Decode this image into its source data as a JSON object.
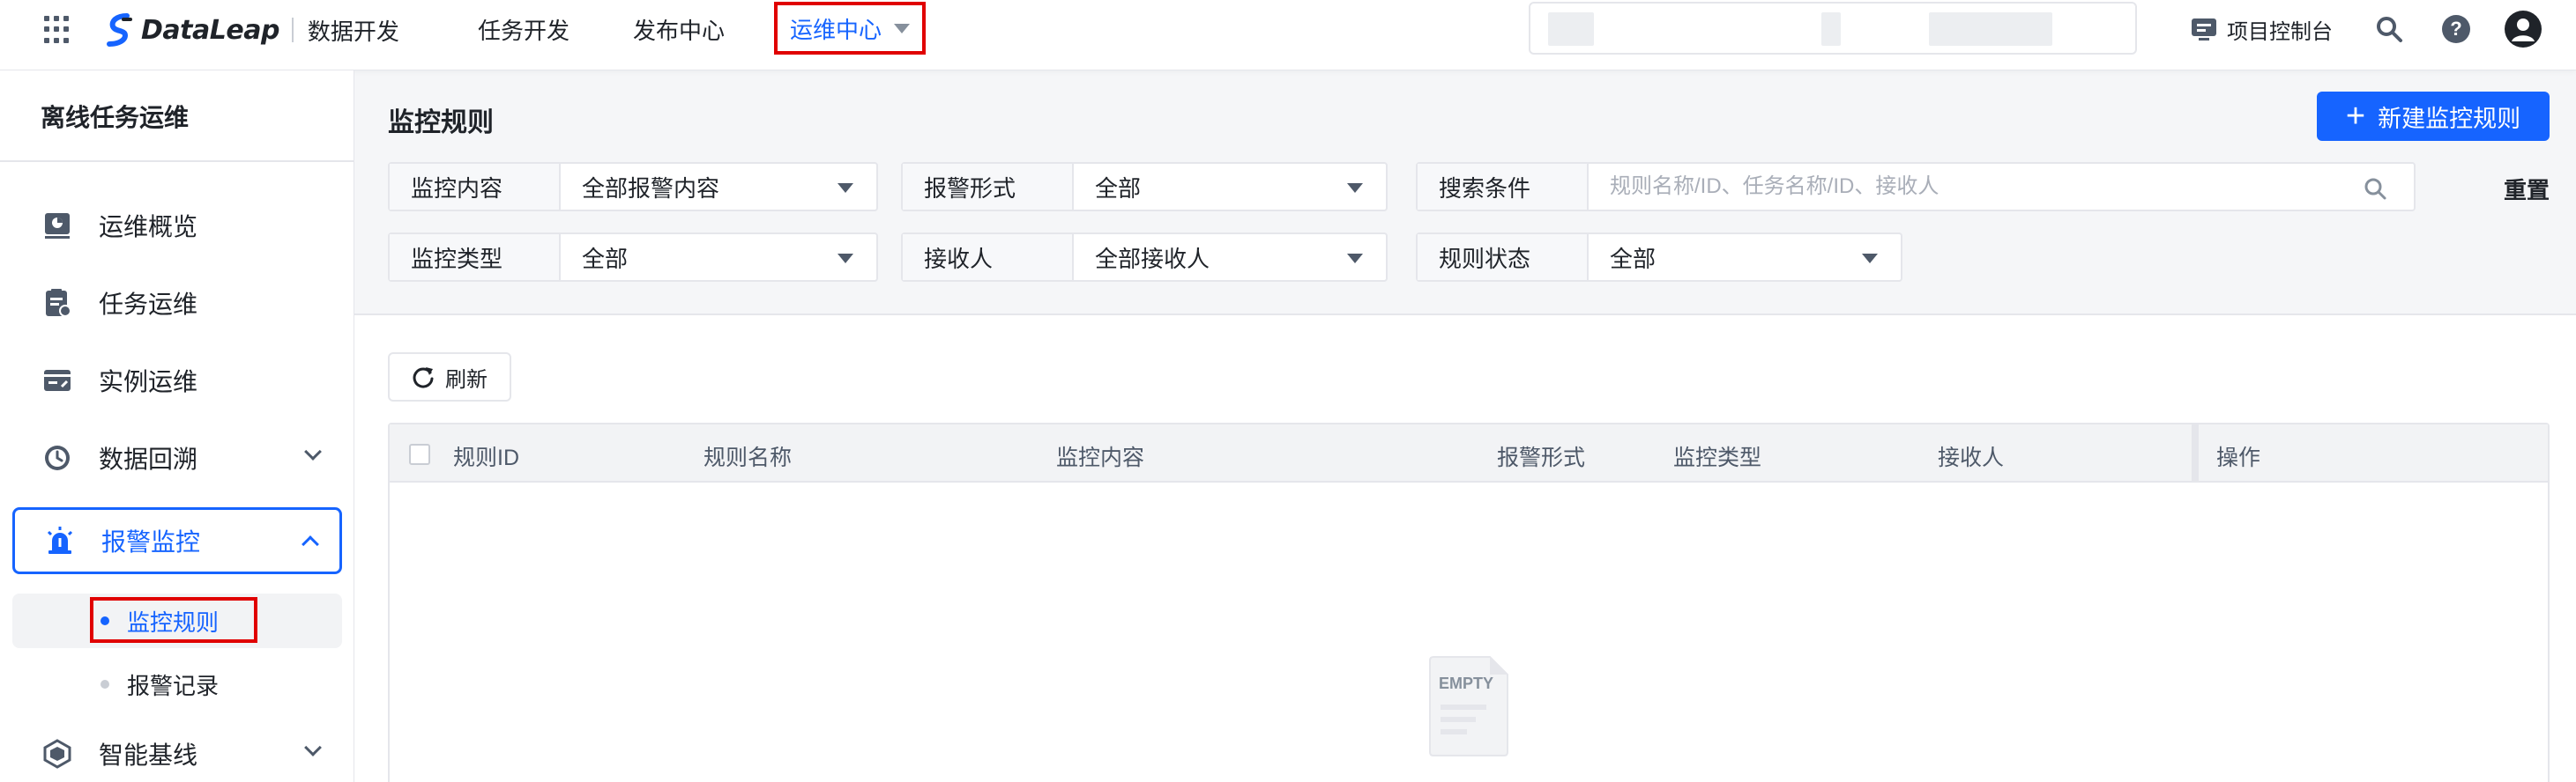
{
  "app": {
    "brand": "DataLeap",
    "product": "数据开发"
  },
  "topnav": {
    "items": [
      "任务开发",
      "发布中心"
    ],
    "active": "运维中心"
  },
  "topright": {
    "console": "项目控制台"
  },
  "sidebar": {
    "title": "离线任务运维",
    "items": [
      {
        "label": "运维概览",
        "icon": "dashboard-icon"
      },
      {
        "label": "任务运维",
        "icon": "task-icon"
      },
      {
        "label": "实例运维",
        "icon": "instance-icon"
      },
      {
        "label": "数据回溯",
        "icon": "history-icon"
      },
      {
        "label": "报警监控",
        "icon": "alarm-icon"
      },
      {
        "label": "智能基线",
        "icon": "baseline-icon"
      }
    ],
    "sub_items": [
      "监控规则",
      "报警记录"
    ]
  },
  "page": {
    "title": "监控规则",
    "new_button": "新建监控规则",
    "reset": "重置",
    "refresh": "刷新"
  },
  "filters": {
    "monitor_content": {
      "label": "监控内容",
      "value": "全部报警内容"
    },
    "alarm_form": {
      "label": "报警形式",
      "value": "全部"
    },
    "search": {
      "label": "搜索条件",
      "placeholder": "规则名称/ID、任务名称/ID、接收人"
    },
    "monitor_type": {
      "label": "监控类型",
      "value": "全部"
    },
    "receiver": {
      "label": "接收人",
      "value": "全部接收人"
    },
    "rule_status": {
      "label": "规则状态",
      "value": "全部"
    }
  },
  "table": {
    "columns": [
      "规则ID",
      "规则名称",
      "监控内容",
      "报警形式",
      "监控类型",
      "接收人",
      "操作"
    ],
    "rows": []
  },
  "empty_state": {
    "label": "EMPTY"
  },
  "colors": {
    "primary": "#1664ff",
    "highlight_border": "#e00000"
  }
}
